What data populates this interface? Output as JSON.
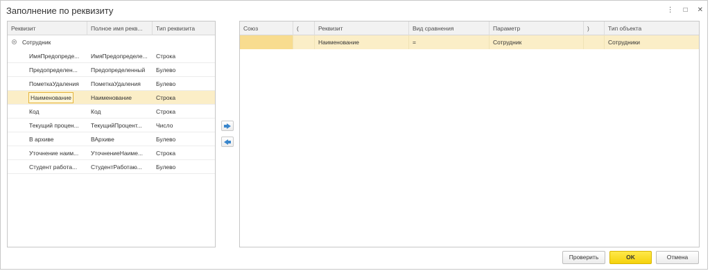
{
  "window": {
    "title": "Заполнение по реквизиту",
    "controls": {
      "more": "⋮",
      "maximize": "□",
      "close": "✕"
    }
  },
  "left_table": {
    "columns": [
      "Реквизит",
      "Полное имя рекв...",
      "Тип реквизита"
    ],
    "group": {
      "label": "Сотрудник",
      "icon": "collapse-icon"
    },
    "rows": [
      {
        "name": "ИмяПредопреде...",
        "full": "ИмяПредопределе...",
        "type": "Строка"
      },
      {
        "name": "Предопределен...",
        "full": "Предопределенный",
        "type": "Булево"
      },
      {
        "name": "ПометкаУдаления",
        "full": "ПометкаУдаления",
        "type": "Булево"
      },
      {
        "name": "Наименование",
        "full": "Наименование",
        "type": "Строка"
      },
      {
        "name": "Код",
        "full": "Код",
        "type": "Строка"
      },
      {
        "name": "Текущий процен...",
        "full": "ТекущийПроцент...",
        "type": "Число"
      },
      {
        "name": "В архиве",
        "full": "ВАрхиве",
        "type": "Булево"
      },
      {
        "name": "Уточнение наим...",
        "full": "УточнениеНаиме...",
        "type": "Строка"
      },
      {
        "name": "Студент работа...",
        "full": "СтудентРаботаю...",
        "type": "Булево"
      }
    ],
    "selected_index": 3
  },
  "transfer": {
    "add_icon": "arrow-right-icon",
    "remove_icon": "arrow-left-icon"
  },
  "right_table": {
    "columns": [
      "Союз",
      "(",
      "Реквизит",
      "Вид сравнения",
      "Параметр",
      ")",
      "Тип объекта"
    ],
    "rows": [
      {
        "union": "",
        "open": "",
        "attr": "Наименование",
        "compare": "=",
        "param": "Сотрудник",
        "close": "",
        "obj_type": "Сотрудники"
      }
    ]
  },
  "buttons": {
    "check": "Проверить",
    "ok": "OK",
    "cancel": "Отмена"
  },
  "colors": {
    "selection": "#fbeec7",
    "active_cell": "#f8dc8f",
    "primary": "#f5d20c",
    "arrow": "#3a86cc"
  }
}
